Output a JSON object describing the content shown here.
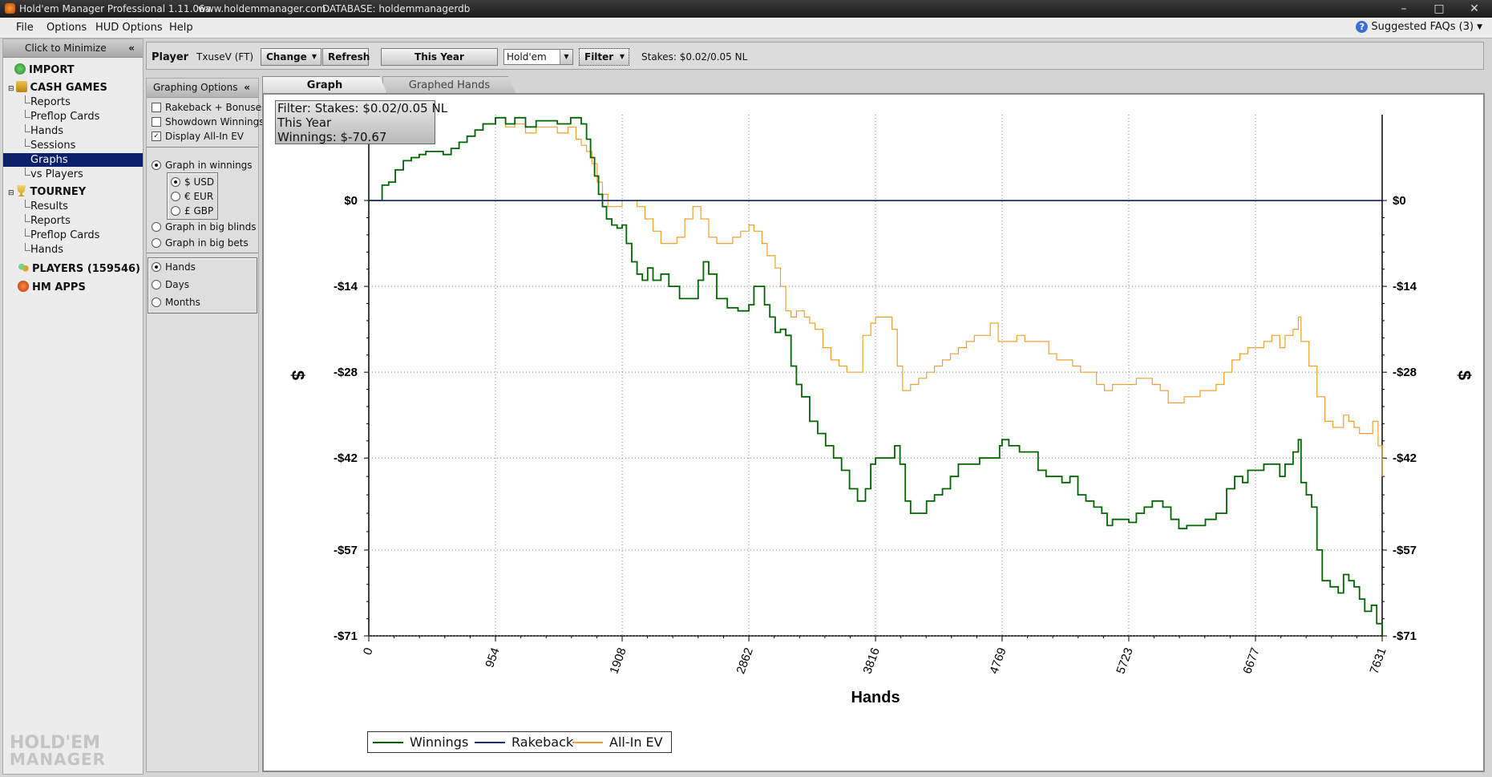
{
  "window": {
    "title": "Hold'em Manager Professional 1.11.06a",
    "url": "www.holdemmanager.com",
    "database": "DATABASE: holdemmanagerdb",
    "buttons": [
      "–",
      "□",
      "✕"
    ]
  },
  "menu": {
    "items": [
      "File",
      "Options",
      "HUD Options",
      "Help"
    ],
    "faq_label": "Suggested FAQs (3)"
  },
  "sidebar": {
    "minimize_label": "Click to Minimize",
    "import_label": "IMPORT",
    "cash_label": "CASH GAMES",
    "cash_items": [
      "Reports",
      "Preflop Cards",
      "Hands",
      "Sessions",
      "Graphs",
      "vs Players"
    ],
    "selected": "Graphs",
    "tourney_label": "TOURNEY",
    "tourney_items": [
      "Results",
      "Reports",
      "Preflop Cards",
      "Hands"
    ],
    "players_label": "PLAYERS (159546)",
    "apps_label": "HM APPS",
    "brand_line1": "HOLD'EM",
    "brand_line2": "MANAGER"
  },
  "playerbar": {
    "player_label": "Player",
    "player_name": "TxuseV (FT)",
    "change_label": "Change",
    "refresh_label": "Refresh",
    "period_label": "This Year",
    "game_value": "Hold'em",
    "filter_label": "Filter",
    "stakes_text": "Stakes: $0.02/0.05 NL"
  },
  "graph_options": {
    "header": "Graphing Options",
    "rakeback_label": "Rakeback + Bonuses",
    "rakeback_checked": false,
    "showdown_label": "Showdown Winnings",
    "showdown_checked": false,
    "allin_label": "Display All-In EV",
    "allin_checked": true,
    "mode_winnings": "Graph in winnings",
    "currency_usd": "$ USD",
    "currency_eur": "€ EUR",
    "currency_gbp": "£ GBP",
    "mode_bb": "Graph in big blinds",
    "mode_bets": "Graph in big bets",
    "axis_hands": "Hands",
    "axis_days": "Days",
    "axis_months": "Months"
  },
  "tabs": [
    "Graph",
    "Graphed Hands"
  ],
  "filter_box": {
    "line1": "Filter: Stakes: $0.02/0.05 NL",
    "line2": "This Year",
    "line3": "Winnings: $-70.67"
  },
  "chart_data": {
    "type": "line",
    "xlabel": "Hands",
    "ylabel": "$",
    "x_ticks": [
      0,
      954,
      1908,
      2862,
      3816,
      4769,
      5723,
      6677,
      7631
    ],
    "y_tick_labels": [
      "$0",
      "-$14",
      "-$28",
      "-$42",
      "-$57",
      "-$71"
    ],
    "y_tick_values": [
      0,
      -14,
      -28,
      -42,
      -57,
      -71
    ],
    "xlim": [
      0,
      7631
    ],
    "ylim": [
      -71,
      14
    ],
    "grid": true,
    "legend": "bottom-left",
    "series": [
      {
        "name": "Winnings",
        "color": "#006400",
        "points": [
          [
            0,
            0
          ],
          [
            60,
            0
          ],
          [
            100,
            2.5
          ],
          [
            150,
            3
          ],
          [
            200,
            5
          ],
          [
            260,
            6.5
          ],
          [
            320,
            7
          ],
          [
            380,
            7.5
          ],
          [
            430,
            8
          ],
          [
            500,
            8
          ],
          [
            560,
            7.5
          ],
          [
            620,
            8.5
          ],
          [
            680,
            9.5
          ],
          [
            740,
            10.5
          ],
          [
            800,
            11.5
          ],
          [
            860,
            12.5
          ],
          [
            954,
            13.5
          ],
          [
            1030,
            12.5
          ],
          [
            1100,
            13.5
          ],
          [
            1180,
            12
          ],
          [
            1260,
            13
          ],
          [
            1340,
            13
          ],
          [
            1420,
            12.5
          ],
          [
            1520,
            13.5
          ],
          [
            1600,
            12.5
          ],
          [
            1640,
            10
          ],
          [
            1670,
            7
          ],
          [
            1700,
            4
          ],
          [
            1730,
            1
          ],
          [
            1760,
            -1
          ],
          [
            1790,
            -3
          ],
          [
            1830,
            -4
          ],
          [
            1870,
            -4.5
          ],
          [
            1908,
            -4
          ],
          [
            1940,
            -7
          ],
          [
            1980,
            -10
          ],
          [
            2020,
            -12
          ],
          [
            2060,
            -13
          ],
          [
            2100,
            -11
          ],
          [
            2140,
            -13
          ],
          [
            2200,
            -12
          ],
          [
            2260,
            -14
          ],
          [
            2340,
            -16
          ],
          [
            2420,
            -16
          ],
          [
            2480,
            -13
          ],
          [
            2520,
            -10
          ],
          [
            2560,
            -12
          ],
          [
            2620,
            -16
          ],
          [
            2700,
            -17.5
          ],
          [
            2780,
            -18
          ],
          [
            2862,
            -17
          ],
          [
            2900,
            -14
          ],
          [
            2940,
            -14
          ],
          [
            2980,
            -17
          ],
          [
            3020,
            -19
          ],
          [
            3060,
            -21.5
          ],
          [
            3100,
            -21
          ],
          [
            3140,
            -22
          ],
          [
            3180,
            -27
          ],
          [
            3220,
            -30
          ],
          [
            3260,
            -32
          ],
          [
            3320,
            -36
          ],
          [
            3380,
            -38
          ],
          [
            3440,
            -40
          ],
          [
            3500,
            -42
          ],
          [
            3560,
            -44
          ],
          [
            3620,
            -47
          ],
          [
            3680,
            -49
          ],
          [
            3740,
            -47
          ],
          [
            3780,
            -43
          ],
          [
            3816,
            -42
          ],
          [
            3880,
            -42
          ],
          [
            3960,
            -40
          ],
          [
            4000,
            -43
          ],
          [
            4040,
            -49
          ],
          [
            4080,
            -51
          ],
          [
            4140,
            -51
          ],
          [
            4200,
            -49
          ],
          [
            4260,
            -48
          ],
          [
            4320,
            -47
          ],
          [
            4380,
            -45
          ],
          [
            4440,
            -43
          ],
          [
            4520,
            -43
          ],
          [
            4600,
            -42
          ],
          [
            4680,
            -42
          ],
          [
            4750,
            -40
          ],
          [
            4769,
            -39
          ],
          [
            4820,
            -40
          ],
          [
            4900,
            -41
          ],
          [
            4960,
            -41
          ],
          [
            5000,
            -41
          ],
          [
            5040,
            -44
          ],
          [
            5100,
            -45
          ],
          [
            5160,
            -45
          ],
          [
            5220,
            -46
          ],
          [
            5280,
            -45
          ],
          [
            5340,
            -48
          ],
          [
            5400,
            -49
          ],
          [
            5460,
            -50
          ],
          [
            5520,
            -51
          ],
          [
            5560,
            -53
          ],
          [
            5600,
            -52
          ],
          [
            5680,
            -52
          ],
          [
            5723,
            -52.5
          ],
          [
            5780,
            -51
          ],
          [
            5840,
            -50
          ],
          [
            5900,
            -49
          ],
          [
            5940,
            -49
          ],
          [
            5980,
            -50
          ],
          [
            6040,
            -52
          ],
          [
            6100,
            -53.5
          ],
          [
            6160,
            -53
          ],
          [
            6220,
            -53
          ],
          [
            6300,
            -52
          ],
          [
            6380,
            -51
          ],
          [
            6460,
            -47
          ],
          [
            6520,
            -45
          ],
          [
            6580,
            -46
          ],
          [
            6620,
            -44
          ],
          [
            6677,
            -44
          ],
          [
            6740,
            -43
          ],
          [
            6800,
            -43
          ],
          [
            6860,
            -45
          ],
          [
            6900,
            -43
          ],
          [
            6960,
            -41
          ],
          [
            7000,
            -39
          ],
          [
            7020,
            -46
          ],
          [
            7060,
            -48
          ],
          [
            7100,
            -50
          ],
          [
            7140,
            -57
          ],
          [
            7180,
            -62
          ],
          [
            7240,
            -63
          ],
          [
            7300,
            -64
          ],
          [
            7340,
            -61
          ],
          [
            7380,
            -62
          ],
          [
            7420,
            -63
          ],
          [
            7460,
            -65
          ],
          [
            7500,
            -67
          ],
          [
            7550,
            -66
          ],
          [
            7590,
            -69
          ],
          [
            7631,
            -71
          ]
        ]
      },
      {
        "name": "Rakeback",
        "color": "#1c2f7a",
        "points": [
          [
            0,
            0
          ],
          [
            7631,
            0
          ]
        ]
      },
      {
        "name": "All-In EV",
        "color": "#f0a030",
        "points": [
          [
            0,
            0
          ],
          [
            60,
            0
          ],
          [
            100,
            2.5
          ],
          [
            150,
            3
          ],
          [
            200,
            5
          ],
          [
            260,
            6.5
          ],
          [
            320,
            7
          ],
          [
            380,
            7.5
          ],
          [
            430,
            8
          ],
          [
            500,
            8
          ],
          [
            560,
            7.5
          ],
          [
            620,
            8.5
          ],
          [
            680,
            9.5
          ],
          [
            740,
            10.5
          ],
          [
            800,
            11.5
          ],
          [
            860,
            12.5
          ],
          [
            954,
            13.5
          ],
          [
            1030,
            12
          ],
          [
            1100,
            12.5
          ],
          [
            1180,
            11
          ],
          [
            1260,
            12
          ],
          [
            1340,
            12
          ],
          [
            1420,
            11
          ],
          [
            1500,
            12
          ],
          [
            1560,
            10
          ],
          [
            1600,
            9
          ],
          [
            1640,
            8
          ],
          [
            1680,
            6
          ],
          [
            1720,
            3
          ],
          [
            1760,
            1
          ],
          [
            1800,
            -1
          ],
          [
            1860,
            -1
          ],
          [
            1908,
            0
          ],
          [
            1960,
            0
          ],
          [
            2020,
            -1
          ],
          [
            2080,
            -3
          ],
          [
            2140,
            -5
          ],
          [
            2200,
            -7
          ],
          [
            2260,
            -7
          ],
          [
            2320,
            -6
          ],
          [
            2380,
            -3
          ],
          [
            2440,
            -1
          ],
          [
            2500,
            -3
          ],
          [
            2560,
            -6
          ],
          [
            2620,
            -7
          ],
          [
            2680,
            -7
          ],
          [
            2740,
            -6
          ],
          [
            2800,
            -5
          ],
          [
            2862,
            -4
          ],
          [
            2900,
            -5
          ],
          [
            2960,
            -7
          ],
          [
            3000,
            -9
          ],
          [
            3060,
            -11
          ],
          [
            3100,
            -14
          ],
          [
            3140,
            -18
          ],
          [
            3180,
            -19
          ],
          [
            3220,
            -18
          ],
          [
            3280,
            -19
          ],
          [
            3320,
            -20
          ],
          [
            3360,
            -21
          ],
          [
            3420,
            -24
          ],
          [
            3480,
            -26
          ],
          [
            3540,
            -27
          ],
          [
            3600,
            -28
          ],
          [
            3660,
            -28
          ],
          [
            3720,
            -22
          ],
          [
            3780,
            -20
          ],
          [
            3816,
            -19
          ],
          [
            3880,
            -19
          ],
          [
            3940,
            -21
          ],
          [
            3980,
            -27
          ],
          [
            4020,
            -31
          ],
          [
            4080,
            -30
          ],
          [
            4140,
            -29
          ],
          [
            4200,
            -28
          ],
          [
            4260,
            -27
          ],
          [
            4320,
            -26
          ],
          [
            4380,
            -25
          ],
          [
            4440,
            -24
          ],
          [
            4500,
            -23
          ],
          [
            4560,
            -22
          ],
          [
            4620,
            -22
          ],
          [
            4680,
            -20
          ],
          [
            4740,
            -23
          ],
          [
            4769,
            -23
          ],
          [
            4820,
            -23
          ],
          [
            4880,
            -22
          ],
          [
            4940,
            -23
          ],
          [
            5000,
            -23
          ],
          [
            5060,
            -23
          ],
          [
            5120,
            -25
          ],
          [
            5180,
            -26
          ],
          [
            5240,
            -26
          ],
          [
            5300,
            -27
          ],
          [
            5360,
            -28
          ],
          [
            5420,
            -28
          ],
          [
            5480,
            -30
          ],
          [
            5540,
            -31
          ],
          [
            5600,
            -30
          ],
          [
            5660,
            -30
          ],
          [
            5723,
            -30
          ],
          [
            5780,
            -29
          ],
          [
            5840,
            -29
          ],
          [
            5900,
            -30
          ],
          [
            5960,
            -31
          ],
          [
            6020,
            -33
          ],
          [
            6080,
            -33
          ],
          [
            6140,
            -32
          ],
          [
            6200,
            -32
          ],
          [
            6260,
            -31
          ],
          [
            6320,
            -31
          ],
          [
            6380,
            -30
          ],
          [
            6440,
            -28
          ],
          [
            6500,
            -26
          ],
          [
            6560,
            -25
          ],
          [
            6620,
            -24
          ],
          [
            6677,
            -24
          ],
          [
            6740,
            -23
          ],
          [
            6800,
            -22
          ],
          [
            6860,
            -24
          ],
          [
            6900,
            -22
          ],
          [
            6960,
            -21
          ],
          [
            7000,
            -19
          ],
          [
            7020,
            -23
          ],
          [
            7080,
            -27
          ],
          [
            7140,
            -32
          ],
          [
            7200,
            -36
          ],
          [
            7260,
            -37
          ],
          [
            7300,
            -37
          ],
          [
            7340,
            -35
          ],
          [
            7380,
            -36
          ],
          [
            7420,
            -37
          ],
          [
            7460,
            -38
          ],
          [
            7500,
            -38
          ],
          [
            7560,
            -36
          ],
          [
            7600,
            -40
          ],
          [
            7631,
            -45
          ]
        ]
      }
    ]
  }
}
